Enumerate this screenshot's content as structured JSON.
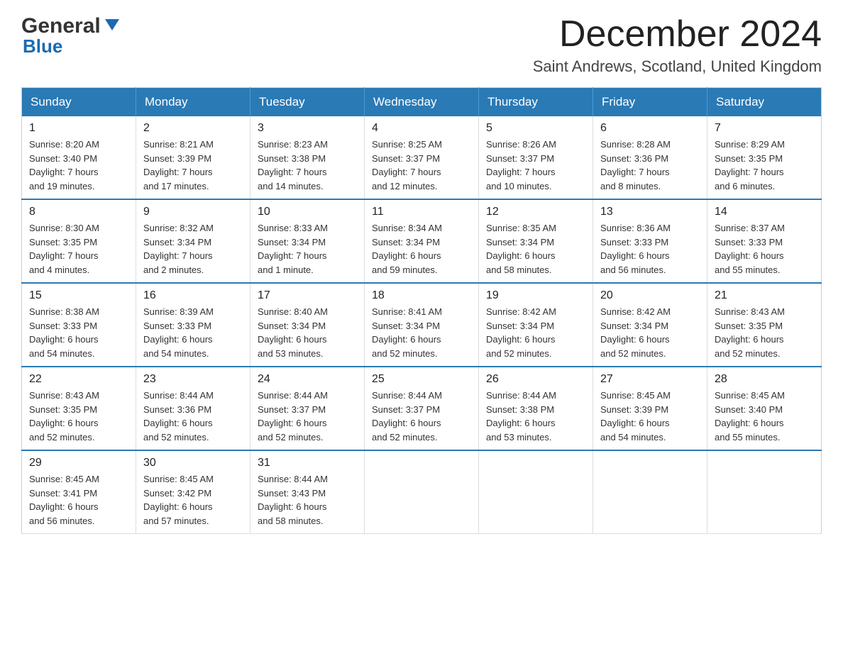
{
  "header": {
    "logo_general": "General",
    "logo_blue": "Blue",
    "title": "December 2024",
    "subtitle": "Saint Andrews, Scotland, United Kingdom"
  },
  "weekdays": [
    "Sunday",
    "Monday",
    "Tuesday",
    "Wednesday",
    "Thursday",
    "Friday",
    "Saturday"
  ],
  "weeks": [
    [
      {
        "day": "1",
        "info": "Sunrise: 8:20 AM\nSunset: 3:40 PM\nDaylight: 7 hours\nand 19 minutes."
      },
      {
        "day": "2",
        "info": "Sunrise: 8:21 AM\nSunset: 3:39 PM\nDaylight: 7 hours\nand 17 minutes."
      },
      {
        "day": "3",
        "info": "Sunrise: 8:23 AM\nSunset: 3:38 PM\nDaylight: 7 hours\nand 14 minutes."
      },
      {
        "day": "4",
        "info": "Sunrise: 8:25 AM\nSunset: 3:37 PM\nDaylight: 7 hours\nand 12 minutes."
      },
      {
        "day": "5",
        "info": "Sunrise: 8:26 AM\nSunset: 3:37 PM\nDaylight: 7 hours\nand 10 minutes."
      },
      {
        "day": "6",
        "info": "Sunrise: 8:28 AM\nSunset: 3:36 PM\nDaylight: 7 hours\nand 8 minutes."
      },
      {
        "day": "7",
        "info": "Sunrise: 8:29 AM\nSunset: 3:35 PM\nDaylight: 7 hours\nand 6 minutes."
      }
    ],
    [
      {
        "day": "8",
        "info": "Sunrise: 8:30 AM\nSunset: 3:35 PM\nDaylight: 7 hours\nand 4 minutes."
      },
      {
        "day": "9",
        "info": "Sunrise: 8:32 AM\nSunset: 3:34 PM\nDaylight: 7 hours\nand 2 minutes."
      },
      {
        "day": "10",
        "info": "Sunrise: 8:33 AM\nSunset: 3:34 PM\nDaylight: 7 hours\nand 1 minute."
      },
      {
        "day": "11",
        "info": "Sunrise: 8:34 AM\nSunset: 3:34 PM\nDaylight: 6 hours\nand 59 minutes."
      },
      {
        "day": "12",
        "info": "Sunrise: 8:35 AM\nSunset: 3:34 PM\nDaylight: 6 hours\nand 58 minutes."
      },
      {
        "day": "13",
        "info": "Sunrise: 8:36 AM\nSunset: 3:33 PM\nDaylight: 6 hours\nand 56 minutes."
      },
      {
        "day": "14",
        "info": "Sunrise: 8:37 AM\nSunset: 3:33 PM\nDaylight: 6 hours\nand 55 minutes."
      }
    ],
    [
      {
        "day": "15",
        "info": "Sunrise: 8:38 AM\nSunset: 3:33 PM\nDaylight: 6 hours\nand 54 minutes."
      },
      {
        "day": "16",
        "info": "Sunrise: 8:39 AM\nSunset: 3:33 PM\nDaylight: 6 hours\nand 54 minutes."
      },
      {
        "day": "17",
        "info": "Sunrise: 8:40 AM\nSunset: 3:34 PM\nDaylight: 6 hours\nand 53 minutes."
      },
      {
        "day": "18",
        "info": "Sunrise: 8:41 AM\nSunset: 3:34 PM\nDaylight: 6 hours\nand 52 minutes."
      },
      {
        "day": "19",
        "info": "Sunrise: 8:42 AM\nSunset: 3:34 PM\nDaylight: 6 hours\nand 52 minutes."
      },
      {
        "day": "20",
        "info": "Sunrise: 8:42 AM\nSunset: 3:34 PM\nDaylight: 6 hours\nand 52 minutes."
      },
      {
        "day": "21",
        "info": "Sunrise: 8:43 AM\nSunset: 3:35 PM\nDaylight: 6 hours\nand 52 minutes."
      }
    ],
    [
      {
        "day": "22",
        "info": "Sunrise: 8:43 AM\nSunset: 3:35 PM\nDaylight: 6 hours\nand 52 minutes."
      },
      {
        "day": "23",
        "info": "Sunrise: 8:44 AM\nSunset: 3:36 PM\nDaylight: 6 hours\nand 52 minutes."
      },
      {
        "day": "24",
        "info": "Sunrise: 8:44 AM\nSunset: 3:37 PM\nDaylight: 6 hours\nand 52 minutes."
      },
      {
        "day": "25",
        "info": "Sunrise: 8:44 AM\nSunset: 3:37 PM\nDaylight: 6 hours\nand 52 minutes."
      },
      {
        "day": "26",
        "info": "Sunrise: 8:44 AM\nSunset: 3:38 PM\nDaylight: 6 hours\nand 53 minutes."
      },
      {
        "day": "27",
        "info": "Sunrise: 8:45 AM\nSunset: 3:39 PM\nDaylight: 6 hours\nand 54 minutes."
      },
      {
        "day": "28",
        "info": "Sunrise: 8:45 AM\nSunset: 3:40 PM\nDaylight: 6 hours\nand 55 minutes."
      }
    ],
    [
      {
        "day": "29",
        "info": "Sunrise: 8:45 AM\nSunset: 3:41 PM\nDaylight: 6 hours\nand 56 minutes."
      },
      {
        "day": "30",
        "info": "Sunrise: 8:45 AM\nSunset: 3:42 PM\nDaylight: 6 hours\nand 57 minutes."
      },
      {
        "day": "31",
        "info": "Sunrise: 8:44 AM\nSunset: 3:43 PM\nDaylight: 6 hours\nand 58 minutes."
      },
      {
        "day": "",
        "info": ""
      },
      {
        "day": "",
        "info": ""
      },
      {
        "day": "",
        "info": ""
      },
      {
        "day": "",
        "info": ""
      }
    ]
  ]
}
